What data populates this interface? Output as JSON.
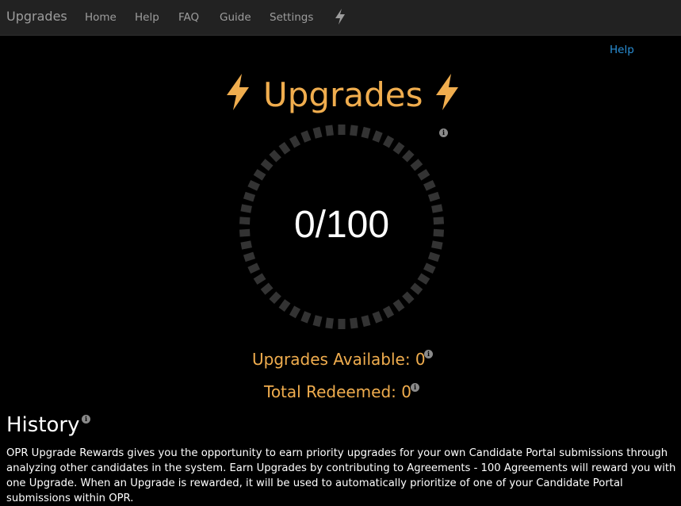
{
  "navbar": {
    "brand": "Upgrades",
    "items": [
      "Home",
      "Help",
      "FAQ",
      "Guide",
      "Settings"
    ],
    "bolt_icon": "lightning-bolt-icon"
  },
  "help_link": "Help",
  "title": {
    "text": "Upgrades",
    "icon": "lightning-bolt-icon",
    "color": "#f0ad4e"
  },
  "progress": {
    "label": "0/100",
    "current": 0,
    "total": 100,
    "segments": 50,
    "track_color": "#333333"
  },
  "stats": {
    "available_label": "Upgrades Available: 0",
    "redeemed_label": "Total Redeemed: 0"
  },
  "history": {
    "title": "History",
    "description": "OPR Upgrade Rewards gives you the opportunity to earn priority upgrades for your own Candidate Portal submissions through analyzing other candidates in the system. Earn Upgrades by contributing to Agreements - 100 Agreements will reward you with one Upgrade. When an Upgrade is rewarded, it will be used to automatically prioritize of one of your Candidate Portal submissions within OPR."
  },
  "colors": {
    "background": "#000000",
    "navbar": "#222222",
    "accent": "#f0ad4e",
    "link": "#2a8fd6"
  }
}
